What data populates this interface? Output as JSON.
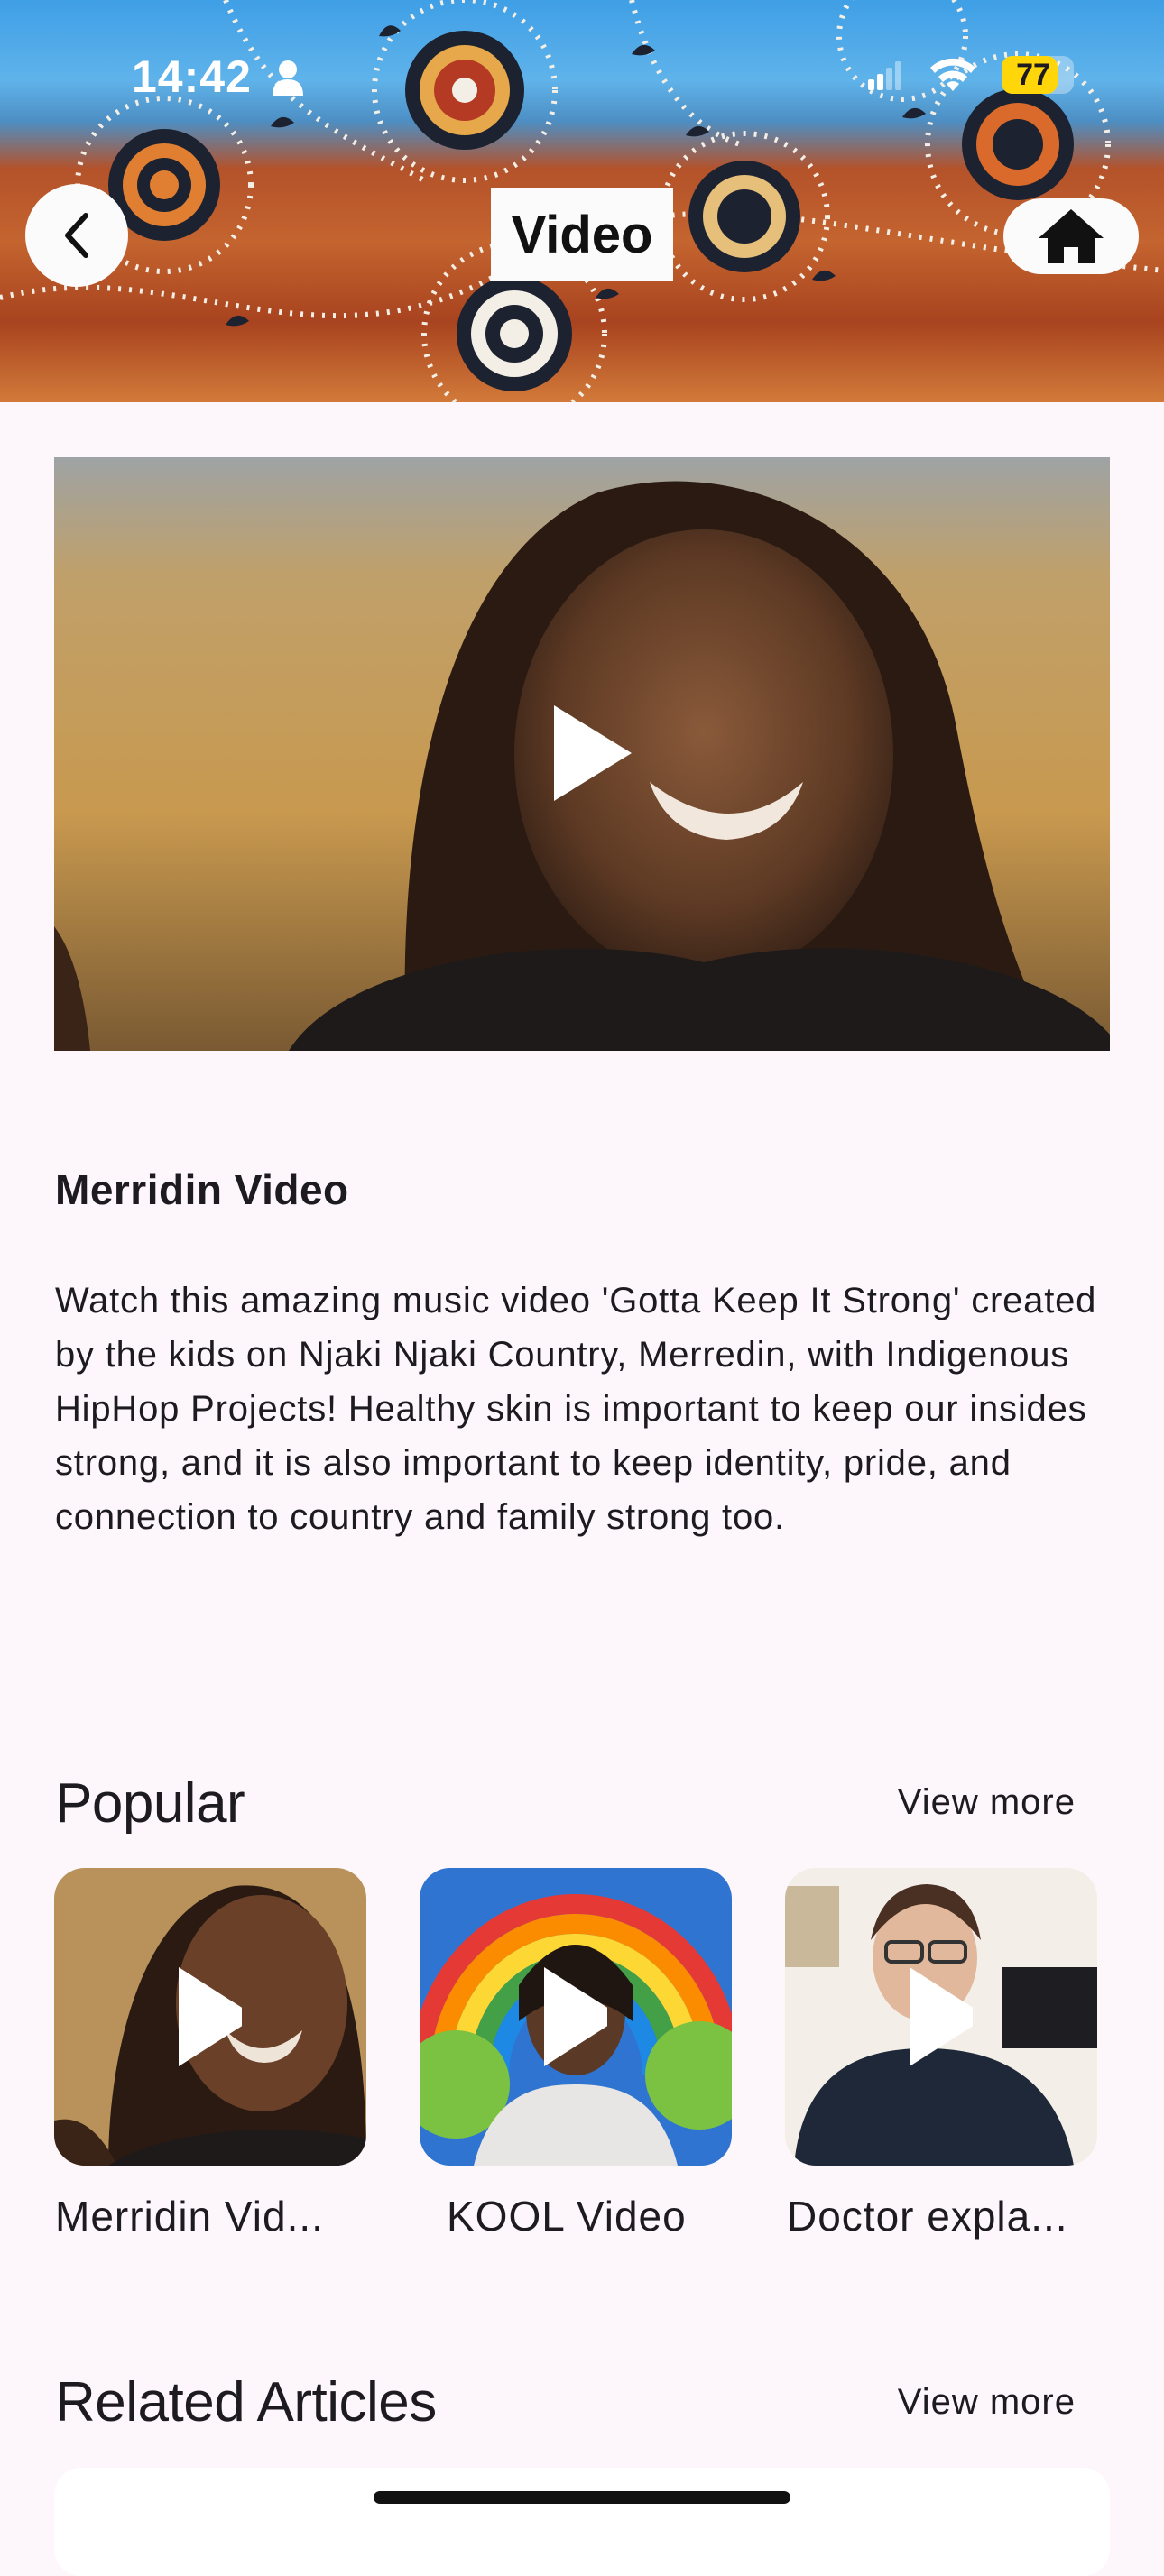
{
  "status_bar": {
    "time": "14:42",
    "battery": "77",
    "battery_level": 0.77
  },
  "header": {
    "title": "Video"
  },
  "video": {
    "title": "Merridin Video",
    "description": "Watch this amazing music video 'Gotta Keep It Strong' created by the kids on Njaki Njaki Country, Merredin, with Indigenous HipHop Projects! Healthy skin is important to keep our insides strong, and it is also important to keep identity, pride, and connection to country and family strong too."
  },
  "popular": {
    "title": "Popular",
    "view_more": "View more",
    "items": [
      {
        "label": "Merridin Vid..."
      },
      {
        "label": "KOOL Video"
      },
      {
        "label": "Doctor expla..."
      }
    ]
  },
  "related": {
    "title": "Related Articles",
    "view_more": "View more"
  }
}
